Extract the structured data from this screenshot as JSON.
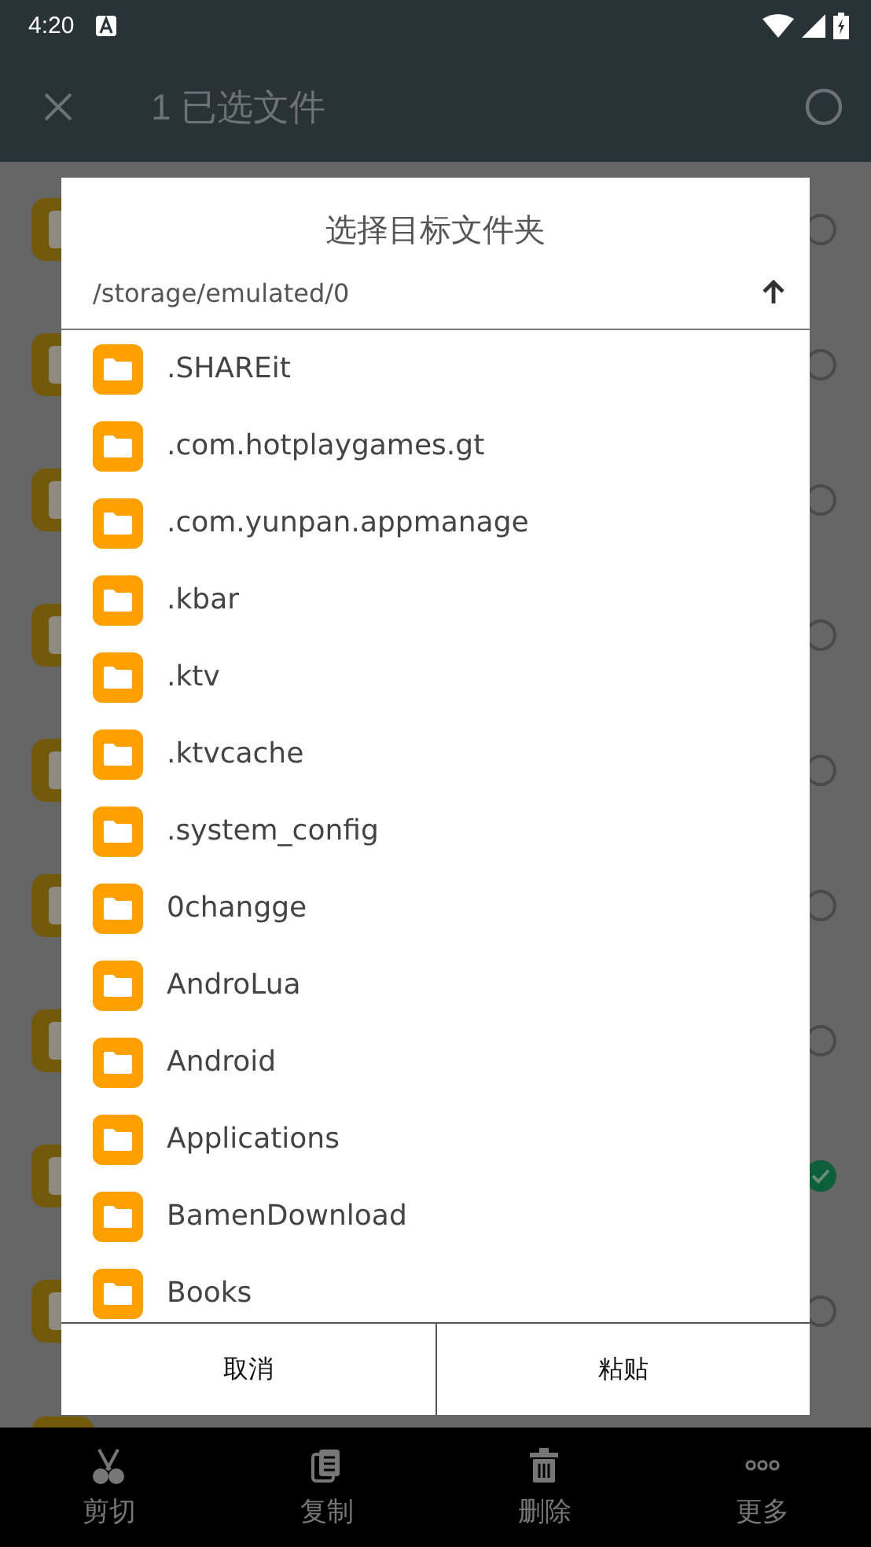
{
  "status_bar": {
    "time": "4:20"
  },
  "toolbar": {
    "title": "1 已选文件"
  },
  "files": [
    {
      "checked": false
    },
    {
      "checked": false
    },
    {
      "checked": false
    },
    {
      "checked": false
    },
    {
      "checked": false
    },
    {
      "checked": false
    },
    {
      "checked": false
    },
    {
      "checked": true
    },
    {
      "checked": false
    }
  ],
  "dialog": {
    "title": "选择目标文件夹",
    "path": "/storage/emulated/0",
    "folders": [
      ".SHAREit",
      ".com.hotplaygames.gt",
      ".com.yunpan.appmanage",
      ".kbar",
      ".ktv",
      ".ktvcache",
      ".system_config",
      "0changge",
      "AndroLua",
      "Android",
      "Applications",
      "BamenDownload",
      "Books"
    ],
    "buttons": [
      "取消",
      "粘贴"
    ]
  },
  "bottom_bar": [
    {
      "kind": "cut",
      "label": "剪切"
    },
    {
      "kind": "copy",
      "label": "复制"
    },
    {
      "kind": "delete",
      "label": "删除"
    },
    {
      "kind": "more",
      "label": "更多"
    }
  ]
}
